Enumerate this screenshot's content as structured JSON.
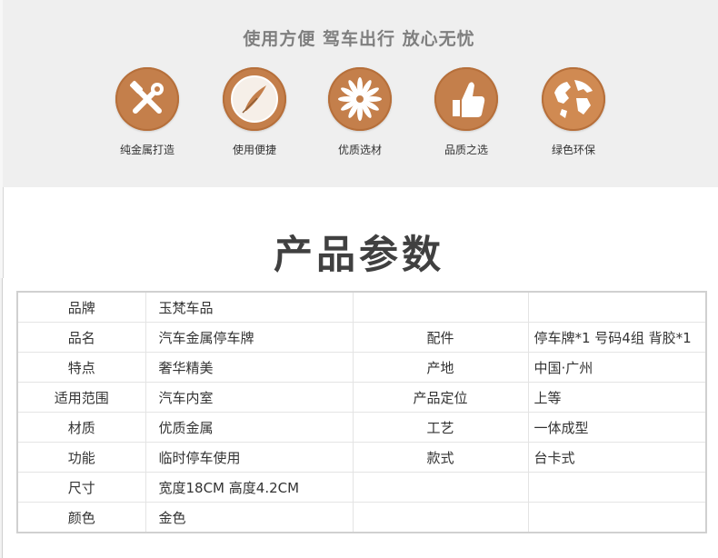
{
  "banner": {
    "slogan": "使用方便 驾车出行 放心无忧",
    "features": [
      {
        "label": "纯金属打造",
        "icon": "tools-icon"
      },
      {
        "label": "使用便捷",
        "icon": "feather-icon"
      },
      {
        "label": "优质选材",
        "icon": "flower-icon"
      },
      {
        "label": "品质之选",
        "icon": "thumbs-up-icon"
      },
      {
        "label": "绿色环保",
        "icon": "globe-icon"
      }
    ],
    "badge_color": "#c47f4b"
  },
  "section": {
    "title": "产品参数"
  },
  "params": {
    "rows": [
      {
        "label": "品牌",
        "value": "玉梵车品",
        "label2": "",
        "value2": ""
      },
      {
        "label": "品名",
        "value": "汽车金属停车牌",
        "label2": "配件",
        "value2": "停车牌*1 号码4组 背胶*1"
      },
      {
        "label": "特点",
        "value": "奢华精美",
        "label2": "产地",
        "value2": "中国·广州"
      },
      {
        "label": "适用范围",
        "value": "汽车内室",
        "label2": "产品定位",
        "value2": "上等"
      },
      {
        "label": "材质",
        "value": "优质金属",
        "label2": "工艺",
        "value2": "一体成型"
      },
      {
        "label": "功能",
        "value": "临时停车使用",
        "label2": "款式",
        "value2": "台卡式"
      },
      {
        "label": "尺寸",
        "value": "宽度18CM 高度4.2CM",
        "label2": "",
        "value2": ""
      },
      {
        "label": "颜色",
        "value": "金色",
        "label2": "",
        "value2": ""
      }
    ]
  }
}
